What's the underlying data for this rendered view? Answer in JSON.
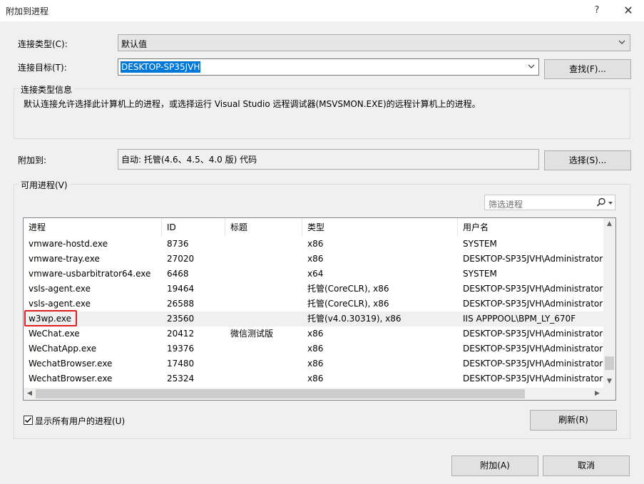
{
  "window": {
    "title": "附加到进程",
    "help_icon": "?",
    "close_icon": "✕"
  },
  "connection": {
    "type_label": "连接类型(C):",
    "type_value": "默认值",
    "target_label": "连接目标(T):",
    "target_value": "DESKTOP-SP35JVH",
    "find_button": "查找(F)..."
  },
  "info": {
    "title": "连接类型信息",
    "text": "默认连接允许选择此计算机上的进程，或选择运行 Visual Studio 远程调试器(MSVSMON.EXE)的远程计算机上的进程。"
  },
  "attach_to": {
    "label": "附加到:",
    "value": "自动: 托管(4.6、4.5、4.0 版) 代码",
    "select_button": "选择(S)..."
  },
  "processes": {
    "group_title": "可用进程(V)",
    "filter_placeholder": "筛选进程",
    "columns": [
      "进程",
      "ID",
      "标题",
      "类型",
      "用户名"
    ],
    "rows": [
      {
        "name": "vmware-hostd.exe",
        "id": "8736",
        "title": "",
        "type": "x86",
        "user": "SYSTEM"
      },
      {
        "name": "vmware-tray.exe",
        "id": "27020",
        "title": "",
        "type": "x86",
        "user": "DESKTOP-SP35JVH\\Administrator"
      },
      {
        "name": "vmware-usbarbitrator64.exe",
        "id": "6468",
        "title": "",
        "type": "x64",
        "user": "SYSTEM"
      },
      {
        "name": "vsls-agent.exe",
        "id": "19464",
        "title": "",
        "type": "托管(CoreCLR), x86",
        "user": "DESKTOP-SP35JVH\\Administrator"
      },
      {
        "name": "vsls-agent.exe",
        "id": "26588",
        "title": "",
        "type": "托管(CoreCLR), x86",
        "user": "DESKTOP-SP35JVH\\Administrator"
      },
      {
        "name": "w3wp.exe",
        "id": "23560",
        "title": "",
        "type": "托管(v4.0.30319), x86",
        "user": "IIS APPPOOL\\BPM_LY_670F"
      },
      {
        "name": "WeChat.exe",
        "id": "20412",
        "title": "微信测试版",
        "type": "x86",
        "user": "DESKTOP-SP35JVH\\Administrator"
      },
      {
        "name": "WeChatApp.exe",
        "id": "19376",
        "title": "",
        "type": "x86",
        "user": "DESKTOP-SP35JVH\\Administrator"
      },
      {
        "name": "WechatBrowser.exe",
        "id": "17480",
        "title": "",
        "type": "x86",
        "user": "DESKTOP-SP35JVH\\Administrator"
      },
      {
        "name": "WechatBrowser.exe",
        "id": "25324",
        "title": "",
        "type": "x86",
        "user": "DESKTOP-SP35JVH\\Administrator"
      }
    ],
    "highlighted_row_name": "w3wp.exe",
    "show_all_users_label": "显示所有用户的进程(U)",
    "show_all_users_checked": true,
    "refresh_button": "刷新(R)"
  },
  "footer": {
    "attach_button": "附加(A)",
    "cancel_button": "取消"
  },
  "colors": {
    "selection": "#0078d7",
    "highlight_box": "#e02020",
    "dialog_bg": "#f0f0f0"
  }
}
